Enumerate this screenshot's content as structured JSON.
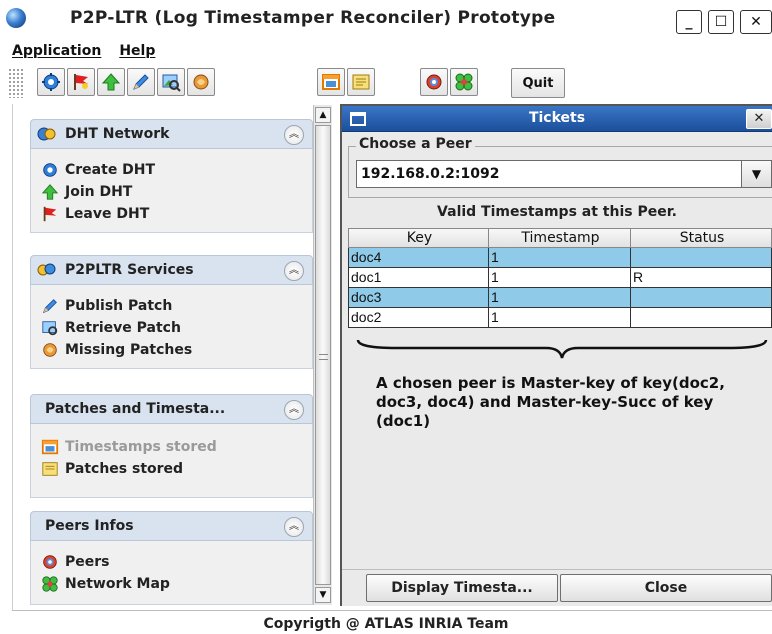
{
  "window": {
    "title": "P2P-LTR (Log Timestamper Reconciler) Prototype",
    "min_glyph": "_",
    "max_glyph": "☐",
    "close_glyph": "✕"
  },
  "menubar": {
    "items": [
      {
        "label": "Application"
      },
      {
        "label": "Help"
      }
    ]
  },
  "toolbar": {
    "buttons": [
      {
        "icon": "gear-network-icon"
      },
      {
        "icon": "red-flag-icon"
      },
      {
        "icon": "green-up-arrow-icon"
      },
      {
        "icon": "pencil-icon"
      },
      {
        "icon": "image-search-icon"
      },
      {
        "icon": "missing-patch-icon"
      },
      {
        "icon": "timestamp-window-icon"
      },
      {
        "icon": "note-icon"
      },
      {
        "icon": "peer-icon"
      },
      {
        "icon": "network-map-icon"
      }
    ],
    "quit_label": "Quit"
  },
  "taskpane": {
    "collapse_glyph": "︽",
    "panels": [
      {
        "title": "DHT Network",
        "items": [
          {
            "label": "Create DHT"
          },
          {
            "label": "Join DHT"
          },
          {
            "label": "Leave DHT"
          }
        ]
      },
      {
        "title": "P2PLTR Services",
        "items": [
          {
            "label": "Publish Patch"
          },
          {
            "label": "Retrieve Patch"
          },
          {
            "label": "Missing Patches"
          }
        ]
      },
      {
        "title": "Patches and Timesta...",
        "items": [
          {
            "label": "Timestamps stored",
            "disabled": true
          },
          {
            "label": "Patches stored"
          }
        ]
      },
      {
        "title": "Peers Infos",
        "items": [
          {
            "label": "Peers"
          },
          {
            "label": "Network Map"
          }
        ]
      }
    ]
  },
  "tickets": {
    "title": "Tickets",
    "close_glyph": "✕",
    "choose_peer_label": "Choose a Peer",
    "peer_value": "192.168.0.2:1092",
    "combo_arrow": "▼",
    "valid_label": "Valid Timestamps at this Peer.",
    "table": {
      "headers": [
        "Key",
        "Timestamp",
        "Status"
      ],
      "rows": [
        {
          "key": "doc4",
          "ts": "1",
          "status": "",
          "selected": true
        },
        {
          "key": "doc1",
          "ts": "1",
          "status": "R",
          "selected": false
        },
        {
          "key": "doc3",
          "ts": "1",
          "status": "",
          "selected": true
        },
        {
          "key": "doc2",
          "ts": "1",
          "status": "",
          "selected": false
        }
      ]
    },
    "annotation": "A chosen peer is Master-key of key(doc2, doc3, doc4) and Master-key-Succ of key (doc1)",
    "display_button": "Display Timesta...",
    "close_button": "Close"
  },
  "scrollbar": {
    "up_glyph": "▲",
    "down_glyph": "▼"
  },
  "footer": {
    "text": "Copyrigth @ ATLAS INRIA Team"
  }
}
